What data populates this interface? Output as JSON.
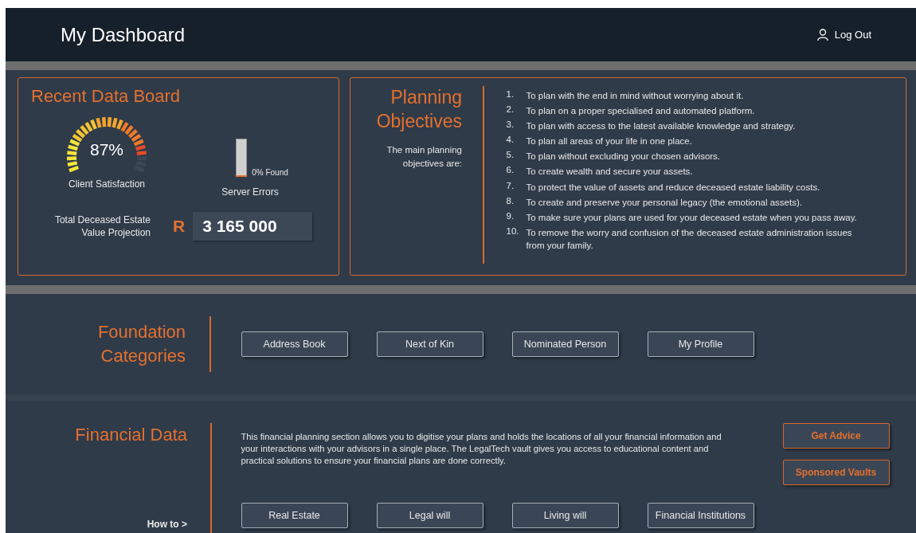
{
  "header": {
    "title": "My Dashboard",
    "logout": "Log Out"
  },
  "recent_data_board": {
    "title": "Recent Data Board",
    "satisfaction": {
      "reading": "87%",
      "label": "Client Satisfaction",
      "level": 0.87
    },
    "server_errors": {
      "reading": "0% Found",
      "label": "Server Errors",
      "level": 0
    },
    "projection": {
      "label": "Total Deceased Estate Value Projection",
      "currency": "R",
      "value": "3 165 000"
    }
  },
  "planning_objectives": {
    "title": "Planning Objectives",
    "intro": "The main planning objectives are:",
    "items": [
      {
        "number": "1.",
        "text": "To plan with the end in mind without worrying about it."
      },
      {
        "number": "2.",
        "text": "To plan on a proper specialised and automated platform."
      },
      {
        "number": "3.",
        "text": "To plan with access to the latest available knowledge and strategy."
      },
      {
        "number": "4.",
        "text": "To plan all areas of your life in one place."
      },
      {
        "number": "5.",
        "text": "To plan without excluding your chosen advisors."
      },
      {
        "number": "6.",
        "text": "To create wealth and secure your assets."
      },
      {
        "number": "7.",
        "text": "To protect the value of assets and reduce deceased estate liability costs."
      },
      {
        "number": "8.",
        "text": "To create and preserve your personal legacy (the emotional assets)."
      },
      {
        "number": "9.",
        "text": "To make sure your plans are used for your deceased estate when you pass away."
      },
      {
        "number": "10.",
        "text": "To remove the worry and confusion of the deceased estate administration issues from your family."
      }
    ]
  },
  "foundation_categories": {
    "title": "Foundation Categories",
    "buttons": [
      "Address Book",
      "Next of Kin",
      "Nominated Person",
      "My Profile"
    ]
  },
  "financial_data": {
    "title": "Financial Data",
    "description": "This financial planning section allows you to digitise your plans and holds the locations of all your financial information and your interactions with your advisors in a single place. The LegalTech vault gives you access to educational content and practical solutions to ensure your financial plans are done correctly.",
    "side_buttons": [
      "Get Advice",
      "Sponsored Vaults"
    ],
    "how_to": "How to >",
    "buttons": [
      "Real Estate",
      "Legal will",
      "Living will",
      "Financial Institutions"
    ]
  }
}
